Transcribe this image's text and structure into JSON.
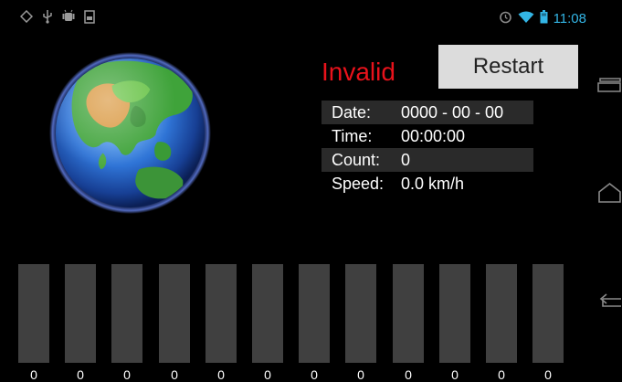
{
  "status_bar": {
    "time": "11:08",
    "left_icons": [
      "location-icon",
      "usb-icon",
      "android-debug-icon",
      "storage-icon"
    ],
    "right_icons": [
      "alarm-icon",
      "wifi-icon",
      "battery-icon"
    ],
    "accent_color": "#33b5e5"
  },
  "gps": {
    "fix_status": "Invalid",
    "fix_status_color": "#e8121b",
    "restart_label": "Restart",
    "rows": [
      {
        "label": "Date:",
        "value": "0000 - 00 - 00"
      },
      {
        "label": "Time:",
        "value": "00:00:00"
      },
      {
        "label": "Count:",
        "value": "0"
      },
      {
        "label": "Speed:",
        "value": "0.0 km/h"
      }
    ]
  },
  "satellites": {
    "signal_values": [
      0,
      0,
      0,
      0,
      0,
      0,
      0,
      0,
      0,
      0,
      0,
      0
    ],
    "labels": [
      "0",
      "0",
      "0",
      "0",
      "0",
      "0",
      "0",
      "0",
      "0",
      "0",
      "0",
      "0"
    ]
  },
  "nav_bar": {
    "icons": [
      "recent-apps-icon",
      "home-icon",
      "back-icon"
    ]
  }
}
